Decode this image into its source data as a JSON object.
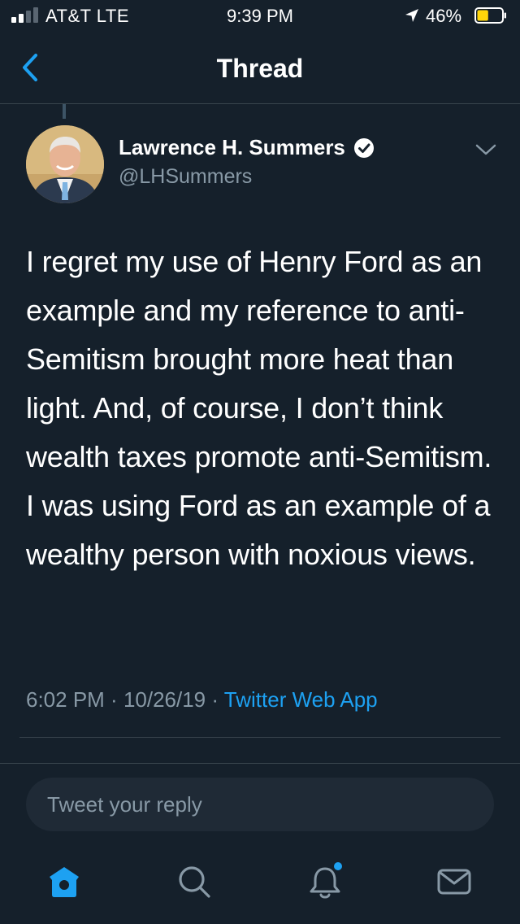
{
  "status_bar": {
    "carrier": "AT&T  LTE",
    "time": "9:39 PM",
    "battery_percent": "46%",
    "battery_level": 0.46,
    "signal_bars_filled": 2,
    "signal_bars_total": 4
  },
  "nav": {
    "title": "Thread"
  },
  "tweet": {
    "author_name": "Lawrence H. Summers",
    "handle": "@LHSummers",
    "verified": true,
    "text": "I regret my use of Henry Ford as an example and my reference to anti-Semitism brought more heat than light. And, of course, I don’t think wealth taxes promote anti-Semitism. I was using Ford as an example of a wealthy person with noxious views.",
    "time": "6:02 PM",
    "date": "10/26/19",
    "separator": " · ",
    "source": "Twitter Web App"
  },
  "reply": {
    "placeholder": "Tweet your reply"
  },
  "tab_bar": {
    "items": [
      {
        "icon": "home-icon",
        "active": true
      },
      {
        "icon": "search-icon",
        "active": false
      },
      {
        "icon": "notifications-icon",
        "active": false,
        "badge": true
      },
      {
        "icon": "messages-icon",
        "active": false
      }
    ]
  },
  "colors": {
    "background": "#15202b",
    "accent": "#1da1f2",
    "secondary_text": "#8899a6",
    "divider": "#38444d",
    "battery": "#ffd60a"
  }
}
